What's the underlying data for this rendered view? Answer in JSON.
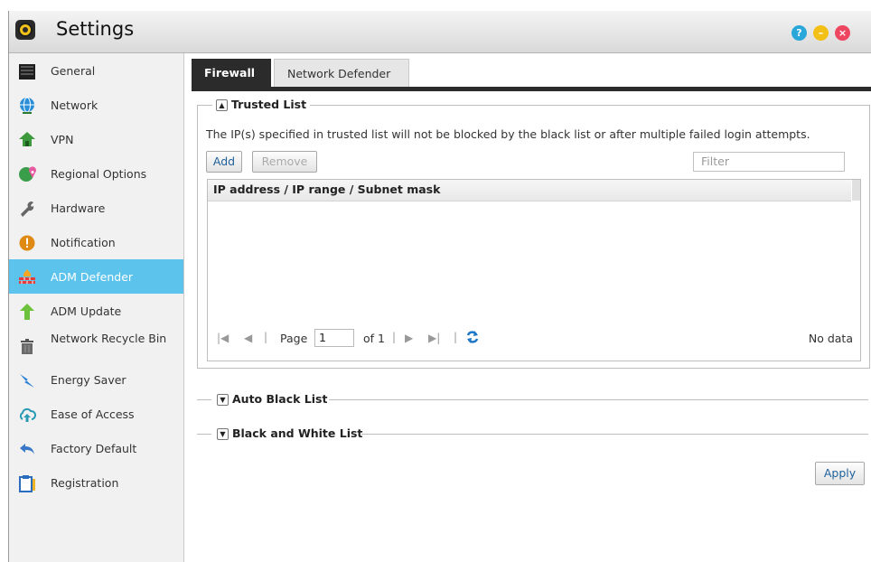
{
  "window": {
    "title": "Settings",
    "controls": [
      "help-icon",
      "minimize-icon",
      "close-icon"
    ]
  },
  "sidebar": {
    "items": [
      {
        "label": "General",
        "icon": "server-icon"
      },
      {
        "label": "Network",
        "icon": "globe-icon"
      },
      {
        "label": "VPN",
        "icon": "vpn-icon"
      },
      {
        "label": "Regional Options",
        "icon": "regional-icon"
      },
      {
        "label": "Hardware",
        "icon": "wrench-icon"
      },
      {
        "label": "Notification",
        "icon": "alert-icon"
      },
      {
        "label": "ADM Defender",
        "icon": "firewall-icon",
        "active": true
      },
      {
        "label": "ADM Update",
        "icon": "update-arrow-icon"
      },
      {
        "label": "Network Recycle Bin",
        "icon": "trash-icon"
      },
      {
        "label": "Energy Saver",
        "icon": "lightning-icon"
      },
      {
        "label": "Ease of Access",
        "icon": "cloud-upload-icon"
      },
      {
        "label": "Factory Default",
        "icon": "undo-icon"
      },
      {
        "label": "Registration",
        "icon": "clipboard-icon"
      }
    ]
  },
  "tabs": [
    {
      "label": "Firewall",
      "active": true
    },
    {
      "label": "Network Defender",
      "active": false
    }
  ],
  "trusted_list": {
    "title": "Trusted List",
    "description": "The IP(s) specified in trusted list will not be blocked by the black list or after multiple failed login attempts.",
    "add_label": "Add",
    "remove_label": "Remove",
    "filter_placeholder": "Filter",
    "column_header": "IP address / IP range / Subnet mask",
    "pager": {
      "page_label": "Page",
      "page_value": "1",
      "of_label": "of 1",
      "status": "No data"
    }
  },
  "sections": {
    "auto_black_list": "Auto Black List",
    "black_white_list": "Black and White List"
  },
  "apply_label": "Apply",
  "colors": {
    "active_nav": "#5cc3ec",
    "tab_active": "#2b2b2b",
    "help": "#2aa7d9",
    "minimize": "#f3c018",
    "close": "#ee4660"
  }
}
